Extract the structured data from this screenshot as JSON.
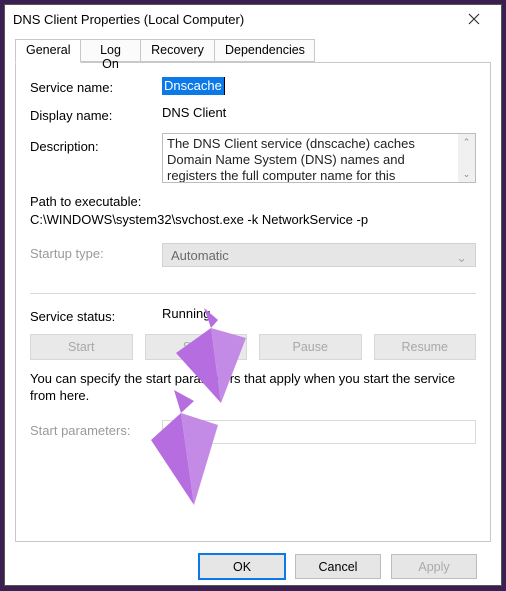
{
  "window": {
    "title": "DNS Client Properties (Local Computer)"
  },
  "tabs": {
    "general": "General",
    "logon": "Log On",
    "recovery": "Recovery",
    "deps": "Dependencies"
  },
  "fields": {
    "service_name_label": "Service name:",
    "service_name_value": "Dnscache",
    "display_name_label": "Display name:",
    "display_name_value": "DNS Client",
    "description_label": "Description:",
    "description_value": "The DNS Client service (dnscache) caches Domain Name System (DNS) names and registers the full computer name for this computer. If the service is",
    "path_label": "Path to executable:",
    "path_value": "C:\\WINDOWS\\system32\\svchost.exe -k NetworkService -p",
    "startup_label": "Startup type:",
    "startup_value": "Automatic",
    "status_label": "Service status:",
    "status_value": "Running",
    "instructions": "You can specify the start parameters that apply when you start the service from here.",
    "start_params_label": "Start parameters:"
  },
  "buttons": {
    "start": "Start",
    "stop": "Stop",
    "pause": "Pause",
    "resume": "Resume",
    "ok": "OK",
    "cancel": "Cancel",
    "apply": "Apply"
  }
}
